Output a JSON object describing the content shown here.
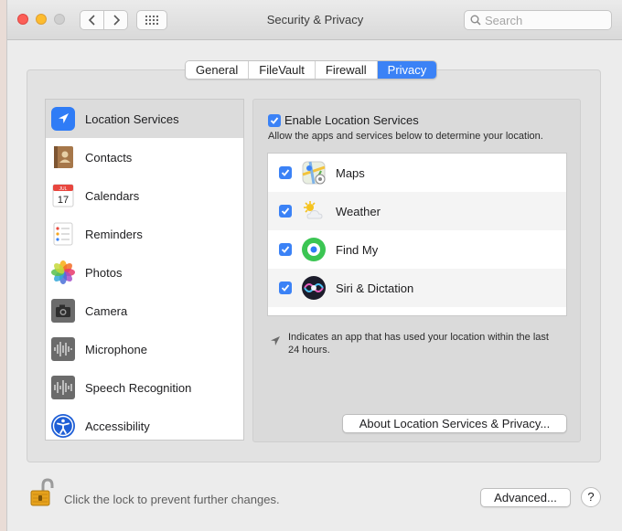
{
  "window": {
    "title": "Security & Privacy"
  },
  "search": {
    "placeholder": "Search"
  },
  "tabs": [
    {
      "label": "General"
    },
    {
      "label": "FileVault"
    },
    {
      "label": "Firewall"
    },
    {
      "label": "Privacy"
    }
  ],
  "sidebar": {
    "items": [
      {
        "label": "Location Services",
        "icon": "location-arrow-icon"
      },
      {
        "label": "Contacts",
        "icon": "contacts-book-icon"
      },
      {
        "label": "Calendars",
        "icon": "calendar-icon"
      },
      {
        "label": "Reminders",
        "icon": "reminders-list-icon"
      },
      {
        "label": "Photos",
        "icon": "photos-flower-icon"
      },
      {
        "label": "Camera",
        "icon": "camera-icon"
      },
      {
        "label": "Microphone",
        "icon": "microphone-waveform-icon"
      },
      {
        "label": "Speech Recognition",
        "icon": "speech-waveform-icon"
      },
      {
        "label": "Accessibility",
        "icon": "accessibility-person-icon"
      }
    ]
  },
  "location": {
    "enable_label": "Enable Location Services",
    "description": "Allow the apps and services below to determine your location.",
    "apps": [
      {
        "label": "Maps",
        "icon": "maps-icon"
      },
      {
        "label": "Weather",
        "icon": "weather-sun-cloud-icon"
      },
      {
        "label": "Find My",
        "icon": "find-my-icon"
      },
      {
        "label": "Siri & Dictation",
        "icon": "siri-icon"
      }
    ],
    "note": "Indicates an app that has used your location within the last 24 hours.",
    "about_button": "About Location Services & Privacy..."
  },
  "footer": {
    "lock_text": "Click the lock to prevent further changes.",
    "advanced_button": "Advanced...",
    "help_label": "?"
  },
  "colors": {
    "accent": "#3b82f6"
  }
}
